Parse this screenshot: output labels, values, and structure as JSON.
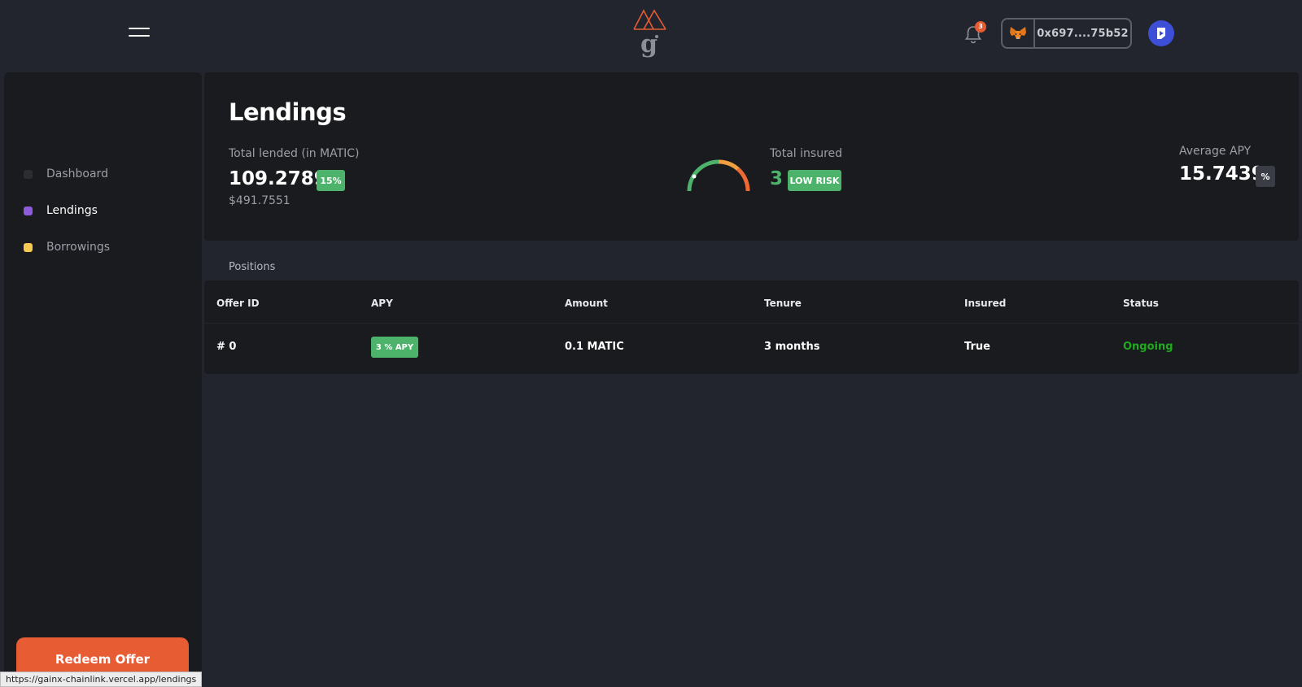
{
  "header": {
    "notification_count": "3",
    "wallet_address": "0x697....75b52",
    "icons": {
      "menu": "hamburger-menu-icon",
      "logo": "gainx-logo",
      "notifications": "bell-icon",
      "wallet": "metamask-fox-icon",
      "profile": "profile-avatar-icon"
    }
  },
  "sidebar": {
    "items": [
      {
        "label": "Dashboard",
        "color": "#2b2d33",
        "active": false
      },
      {
        "label": "Lendings",
        "color": "#8e5cdb",
        "active": true
      },
      {
        "label": "Borrowings",
        "color": "#f6c950",
        "active": false
      }
    ],
    "cta_label": "Redeem Offer"
  },
  "status_bar_url": "https://gainx-chainlink.vercel.app/lendings",
  "summary": {
    "title": "Lendings",
    "total_lended": {
      "label": "Total lended (in MATIC)",
      "value": "109.2789",
      "badge": "15%",
      "usd_value": "$491.7551"
    },
    "total_insured": {
      "label": "Total insured",
      "value": "3",
      "badge": "LOW RISK"
    },
    "average_apy": {
      "label": "Average APY",
      "value": "15.7439",
      "badge": "%"
    },
    "risk_gauge": {
      "level": 0.1,
      "colors": [
        "#4db36b",
        "#f0a040",
        "#ee6a35"
      ]
    }
  },
  "positions": {
    "label": "Positions",
    "columns": [
      "Offer ID",
      "APY",
      "Amount",
      "Tenure",
      "Insured",
      "Status"
    ],
    "rows": [
      {
        "offer_id": "# 0",
        "apy": "3 % APY",
        "amount": "0.1 MATIC",
        "tenure": "3 months",
        "insured": "True",
        "status": "Ongoing",
        "status_color": "#1faa1f"
      }
    ]
  },
  "colors": {
    "background": "#22252d",
    "panel": "#1a1b1f",
    "accent": "#e85c34",
    "positive": "#4db36b"
  }
}
